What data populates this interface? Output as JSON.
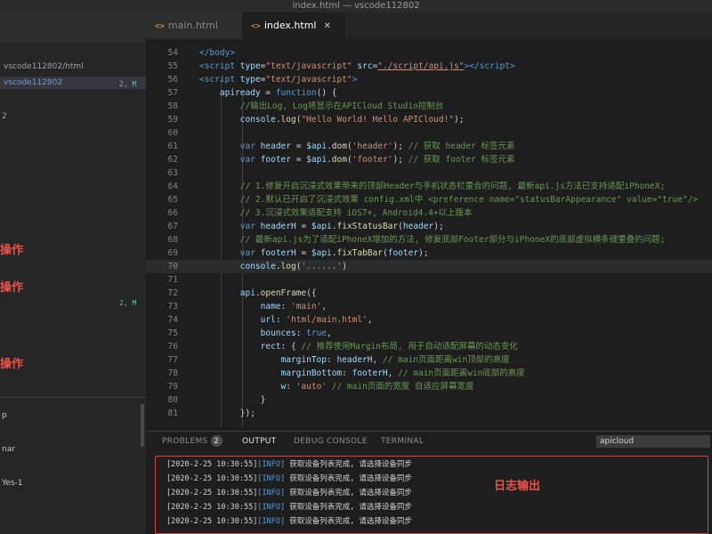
{
  "window": {
    "title": "index.html — vscode112802"
  },
  "sidebar": {
    "project_name": "vscode112802/html",
    "selected_item": "vscode112802",
    "selected_badge": "2, M",
    "indicator": "2",
    "badge_middle": "2, M",
    "annotations": [
      "操作",
      "操作",
      "操作"
    ],
    "bottom_items": [
      "p",
      "nar",
      "Yes-1"
    ]
  },
  "tabs": [
    {
      "icon": "<>",
      "label": "main.html",
      "active": false
    },
    {
      "icon": "<>",
      "label": "index.html",
      "active": true,
      "close": "✕"
    }
  ],
  "editor": {
    "lines": [
      {
        "n": "54",
        "html": "<span class='tag'>&lt;/body&gt;</span>"
      },
      {
        "n": "55",
        "html": "<span class='tag'>&lt;script</span> <span class='attr'>type</span>=<span class='s'>\"text/javascript\"</span> <span class='attr'>src</span>=<span class='str'>\"./script/api.js\"</span><span class='tag'>&gt;&lt;/script&gt;</span>"
      },
      {
        "n": "56",
        "html": "<span class='tag'>&lt;script</span> <span class='attr'>type</span>=<span class='s'>\"text/javascript\"</span><span class='tag'>&gt;</span>"
      },
      {
        "n": "57",
        "html": "    <span class='v'>apiready</span> = <span class='k'>function</span>() {"
      },
      {
        "n": "58",
        "html": "        <span class='c'>//输出Log, Log将显示在APICloud Studio控制台</span>"
      },
      {
        "n": "59",
        "html": "        <span class='v'>console</span>.<span class='f'>log</span>(<span class='s'>\"Hello World! Hello APICloud!\"</span>);"
      },
      {
        "n": "60",
        "html": ""
      },
      {
        "n": "61",
        "html": "        <span class='k'>var</span> <span class='v'>header</span> = <span class='v'>$api</span>.<span class='f'>dom</span>(<span class='s'>'header'</span>); <span class='c'>// 获取 header 标签元素</span>"
      },
      {
        "n": "62",
        "html": "        <span class='k'>var</span> <span class='v'>footer</span> = <span class='v'>$api</span>.<span class='f'>dom</span>(<span class='s'>'footer'</span>); <span class='c'>// 获取 footer 标签元素</span>"
      },
      {
        "n": "63",
        "html": ""
      },
      {
        "n": "64",
        "html": "        <span class='c'>// 1.修复开启沉浸式效果带来的顶部Header与手机状态栏重合的问题, 最新api.js方法已支持适配iPhoneX;</span>"
      },
      {
        "n": "65",
        "html": "        <span class='c'>// 2.默认已开启了沉浸式效果 config.xml中 &lt;preference name=\"statusBarAppearance\" value=\"true\"/&gt;</span>"
      },
      {
        "n": "66",
        "html": "        <span class='c'>// 3.沉浸式效果适配支持 iOS7+, Android4.4+以上版本</span>"
      },
      {
        "n": "67",
        "html": "        <span class='k'>var</span> <span class='v'>headerH</span> = <span class='v'>$api</span>.<span class='f'>fixStatusBar</span>(<span class='v'>header</span>);"
      },
      {
        "n": "68",
        "html": "        <span class='c'>// 最新api.js为了适配iPhoneX增加的方法, 修复底部Footer部分与iPhoneX的底部虚拟横条键重叠的问题;</span>"
      },
      {
        "n": "69",
        "html": "        <span class='k'>var</span> <span class='v'>footerH</span> = <span class='v'>$api</span>.<span class='f'>fixTabBar</span>(<span class='v'>footer</span>);"
      },
      {
        "n": "70",
        "html": "        <span class='v'>console</span>.<span class='f'>log</span>(<span class='s'>'......'</span>)"
      },
      {
        "n": "71",
        "html": ""
      },
      {
        "n": "72",
        "html": "        <span class='v'>api</span>.<span class='f'>openFrame</span>({"
      },
      {
        "n": "73",
        "html": "            <span class='v'>name</span>: <span class='s'>'main'</span>,"
      },
      {
        "n": "74",
        "html": "            <span class='v'>url</span>: <span class='s'>'html/main.html'</span>,"
      },
      {
        "n": "75",
        "html": "            <span class='v'>bounces</span>: <span class='k'>true</span>,"
      },
      {
        "n": "76",
        "html": "            <span class='v'>rect</span>: { <span class='c'>// 推荐使用Margin布局, 用于自动适配屏幕的动态变化</span>"
      },
      {
        "n": "77",
        "html": "                <span class='v'>marginTop</span>: <span class='v'>headerH</span>, <span class='c'>// main页面距离win顶部的高度</span>"
      },
      {
        "n": "78",
        "html": "                <span class='v'>marginBottom</span>: <span class='v'>footerH</span>, <span class='c'>// main页面距离win底部的高度</span>"
      },
      {
        "n": "79",
        "html": "                <span class='v'>w</span>: <span class='s'>'auto'</span> <span class='c'>// main页面的宽度 自适应屏幕宽度</span>"
      },
      {
        "n": "80",
        "html": "            }"
      },
      {
        "n": "81",
        "html": "        });"
      }
    ]
  },
  "panel": {
    "tabs": [
      "PROBLEMS",
      "OUTPUT",
      "DEBUG CONSOLE",
      "TERMINAL"
    ],
    "problems_count": "2",
    "active_tab": "OUTPUT",
    "output_channel": "apicloud",
    "annotation": "日志输出",
    "logs": [
      {
        "time": "[2020-2-25 10:30:55]",
        "level": "[INFO]",
        "msg": "获取设备列表完成, 请选择设备同步"
      },
      {
        "time": "[2020-2-25 10:30:55]",
        "level": "[INFO]",
        "msg": "获取设备列表完成, 请选择设备同步"
      },
      {
        "time": "[2020-2-25 10:30:55]",
        "level": "[INFO]",
        "msg": "获取设备列表完成, 请选择设备同步"
      },
      {
        "time": "[2020-2-25 10:30:55]",
        "level": "[INFO]",
        "msg": "获取设备列表完成, 请选择设备同步"
      },
      {
        "time": "[2020-2-25 10:30:55]",
        "level": "[INFO]",
        "msg": "获取设备列表完成, 请选择设备同步"
      }
    ]
  }
}
